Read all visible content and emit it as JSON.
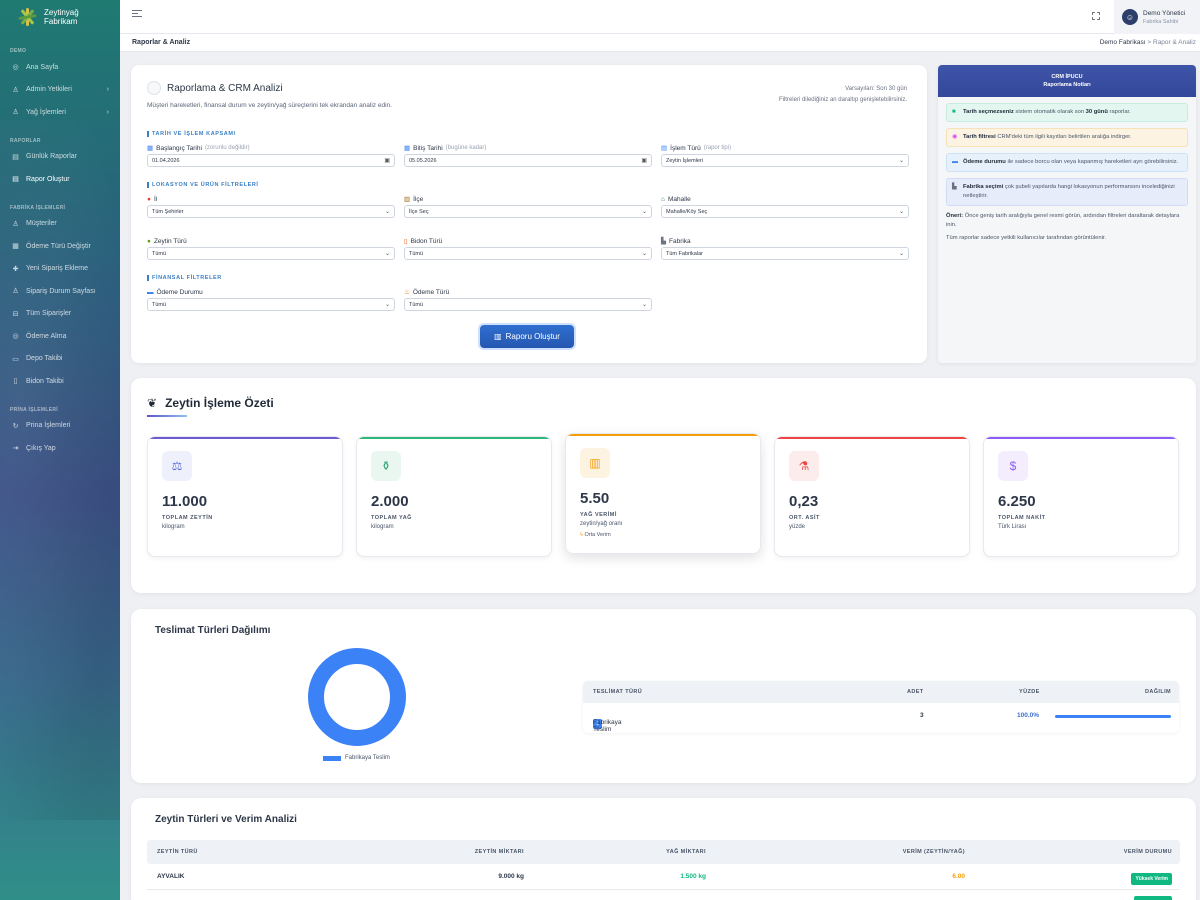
{
  "brand": {
    "line1": "Zeytinyağ",
    "line2": "Fabrikam"
  },
  "sidebar": {
    "sec_demo": "DEMO",
    "home": "Ana Sayfa",
    "admin": "Admin Yetkileri",
    "oil_ops": "Yağ İşlemleri",
    "sec_reports": "RAPORLAR",
    "daily": "Günlük Raporlar",
    "create": "Rapor Oluştur",
    "sec_factory": "FABRİKA İŞLEMLERİ",
    "customers": "Müşteriler",
    "payment_type": "Ödeme Türü Değiştir",
    "new_order": "Yeni Sipariş Ekleme",
    "order_status": "Sipariş Durum Sayfası",
    "all_orders": "Tüm Siparişler",
    "payment_get": "Ödeme Alma",
    "depot": "Depo Takibi",
    "bidon": "Bidon Takibi",
    "sec_prina": "PRİNA İŞLEMLERİ",
    "prina": "Prina İşlemleri",
    "logout": "Çıkış Yap"
  },
  "user": {
    "name": "Demo Yönetici",
    "role": "Fabrika Sahibi"
  },
  "breadcrumb": {
    "title": "Raporlar & Analiz",
    "root": "Demo Fabrikası",
    "sep": ">",
    "current": "Rapor & Analiz"
  },
  "report": {
    "title": "Raporlama & CRM Analizi",
    "desc": "Müşteri hareketleri, finansal durum ve zeytin/yağ süreçlerini tek ekrandan analiz edin.",
    "default_range": "Varsayılan: Son 30 gün",
    "expand_note": "Filtreleri dilediğiniz an daraltıp genişletebilirsiniz.",
    "sec_date": "TARİH VE İŞLEM KAPSAMI",
    "start_label": "Başlangıç Tarihi",
    "start_hint": "(zorunlu değildir)",
    "start_value": "01.04.2026",
    "end_label": "Bitiş Tarihi",
    "end_hint": "(bugüne kadar)",
    "end_value": "05.05.2026",
    "type_label": "İşlem Türü",
    "type_hint": "(rapor tipi)",
    "type_value": "Zeytin İşlemleri",
    "sec_loc": "LOKASYON VE ÜRÜN FİLTRELERİ",
    "city_label": "İl",
    "city_value": "Tüm Şehirler",
    "district_label": "İlçe",
    "district_value": "İlçe Seç",
    "hood_label": "Mahalle",
    "hood_value": "Mahalle/Köy Seç",
    "olive_label": "Zeytin Türü",
    "olive_value": "Tümü",
    "bidon_label": "Bidon Türü",
    "bidon_value": "Tümü",
    "factory_label": "Fabrika",
    "factory_value": "Tüm Fabrikalar",
    "sec_fin": "FİNANSAL FİLTRELER",
    "paystat_label": "Ödeme Durumu",
    "paystat_value": "Tümü",
    "paytype_label": "Ödeme Türü",
    "paytype_value": "Tümü",
    "button": "Raporu Oluştur"
  },
  "tips": {
    "head1": "CRM İPUCU",
    "head2": "Raporlama Notları",
    "t1_b": "Tarih seçmezseniz",
    "t1": " sistem otomatik olarak son ",
    "t1_b2": "30 günü",
    "t1_end": " raporlar.",
    "t2_b": "Tarih filtresi",
    "t2": " CRM'deki tüm ilgili kayıtları belirtilen aralığa indirger.",
    "t3_b": "Ödeme durumu",
    "t3": " ile sadece borcu olan veya kapanmış hareketleri ayrı görebilirsiniz.",
    "t4_b": "Fabrika seçimi",
    "t4": " çok şubeli yapılarda hangi lokasyonun performansını incelediğinizi netleştirir.",
    "n1_b": "Öneri:",
    "n1": " Önce geniş tarih aralığıyla genel resmi görün, ardından filtreleri daraltarak detaylara inin.",
    "n2": "Tüm raporlar sadece yetkili kullanıcılar tarafından görüntülenir."
  },
  "summary": {
    "title": "Zeytin İşleme Özeti",
    "cards": [
      {
        "value": "11.000",
        "label": "TOPLAM ZEYTİN",
        "unit": "kilogram",
        "color": "#6d5bd0"
      },
      {
        "value": "2.000",
        "label": "TOPLAM YAĞ",
        "unit": "kilogram",
        "color": "#2fb87a"
      },
      {
        "value": "5.50",
        "label": "YAĞ VERİMİ",
        "unit": "zeytin/yağ oranı",
        "extra": "Orta Verim",
        "color": "#f59e0b"
      },
      {
        "value": "0,23",
        "label": "ORT. ASİT",
        "unit": "yüzde",
        "color": "#ef4444"
      },
      {
        "value": "6.250",
        "label": "TOPLAM NAKİT",
        "unit": "Türk Lirası",
        "color": "#8b5cf6"
      }
    ]
  },
  "delivery": {
    "title": "Teslimat Türleri Dağılımı",
    "legend": "Fabrikaya Teslim",
    "headers": [
      "TESLİMAT TÜRÜ",
      "ADET",
      "YÜZDE",
      "DAĞILIM"
    ],
    "row": {
      "num": "1",
      "name": "Fabrikaya Teslim",
      "count": "3",
      "pct": "100.0%"
    }
  },
  "chart_data": {
    "type": "pie",
    "categories": [
      "Fabrikaya Teslim"
    ],
    "values": [
      100
    ],
    "colors": [
      "#3b82f6"
    ]
  },
  "varieties": {
    "title": "Zeytin Türleri ve Verim Analizi",
    "headers": [
      "ZEYTİN TÜRÜ",
      "ZEYTİN MİKTARI",
      "YAĞ MİKTARI",
      "VERİM (ZEYTİN/YAĞ)",
      "VERİM DURUMU"
    ],
    "row": {
      "name": "AYVALIK",
      "olive": "9.000 kg",
      "oil": "1.500 kg",
      "yield": "6.00",
      "status": "Yüksek Verim"
    }
  }
}
